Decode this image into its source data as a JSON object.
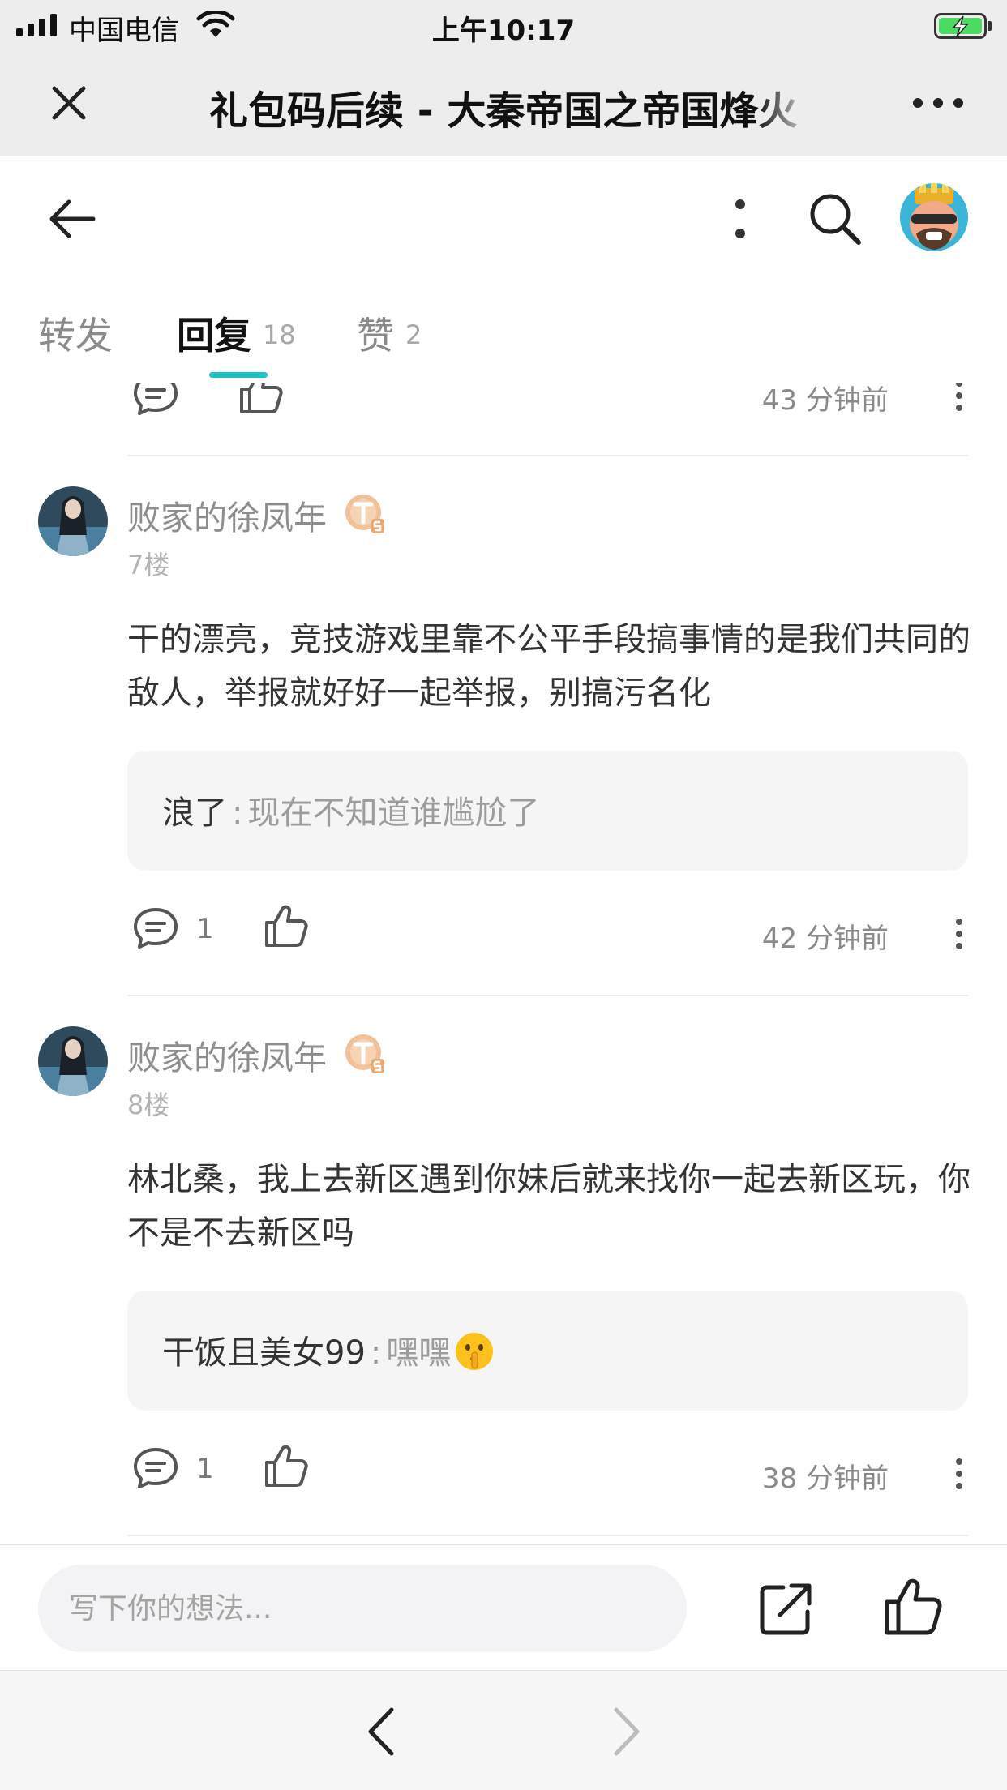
{
  "status_bar": {
    "carrier": "中国电信",
    "time": "上午10:17"
  },
  "wechat_bar": {
    "title": "礼包码后续 - 大秦帝国之帝国烽火"
  },
  "tabs": [
    {
      "label": "转发",
      "count": ""
    },
    {
      "label": "回复",
      "count": "18"
    },
    {
      "label": "赞",
      "count": "2"
    }
  ],
  "comments": [
    {
      "reply_count": "",
      "time": "43 分钟前"
    },
    {
      "user": "败家的徐凤年",
      "floor": "7楼",
      "text": "干的漂亮，竞技游戏里靠不公平手段搞事情的是我们共同的敌人，举报就好好一起举报，别搞污名化",
      "reply": {
        "user": "浪了",
        "sep": ":",
        "text": "现在不知道谁尴尬了"
      },
      "reply_count": "1",
      "time": "42 分钟前"
    },
    {
      "user": "败家的徐凤年",
      "floor": "8楼",
      "text": "林北桑，我上去新区遇到你妹后就来找你一起去新区玩，你不是不去新区吗",
      "reply": {
        "user": "干饭且美女99",
        "sep": ":",
        "text": "嘿嘿"
      },
      "reply_count": "1",
      "time": "38 分钟前"
    }
  ],
  "input_bar": {
    "placeholder": "写下你的想法..."
  },
  "icons": {
    "close": "close-icon",
    "more": "more-horizontal-icon",
    "back": "arrow-left-icon",
    "kebab": "more-vertical-icon",
    "search": "search-icon",
    "comment": "comment-bubble-icon",
    "like": "thumbs-up-icon",
    "share": "share-icon",
    "badge": "level-badge-icon",
    "emoji": "shushing-face-emoji"
  },
  "colors": {
    "accent": "#1fc1c9",
    "badge": "#f1c19a"
  }
}
